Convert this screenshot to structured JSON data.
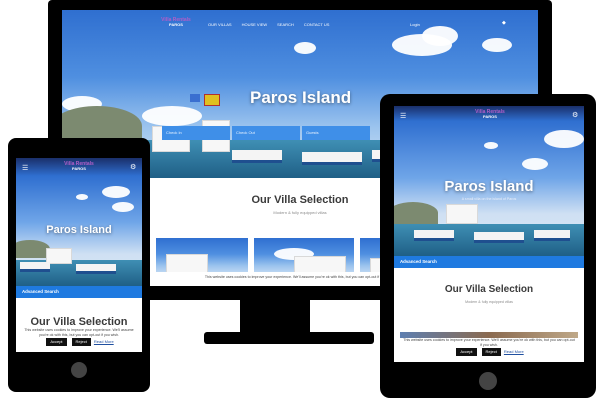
{
  "desktop": {
    "nav": {
      "brand_title": "Villa Rentals",
      "brand_sub": "PAROS",
      "links": [
        "OUR VILLAS",
        "HOUSE VIEW",
        "SEARCH",
        "CONTACT US"
      ],
      "login": "Login"
    },
    "hero_title": "Paros Island",
    "search": {
      "field1": "Check In",
      "field2": "Check Out",
      "field3": "Guests"
    },
    "selection_title": "Our Villa Selection",
    "selection_sub": "Modern & fully equipped villas",
    "cookie_text": "This website uses cookies to improve your experience. We'll assume you're ok with this, but you can opt-out if you wish."
  },
  "phone": {
    "brand_title": "Villa Rentals",
    "brand_sub": "PAROS",
    "hero_title": "Paros Island",
    "advanced_search": "Advanced Search",
    "selection_title": "Our Villa Selection",
    "cookie_text": "This website uses cookies to improve your experience. We'll assume you're ok with this, but you can opt-out if you wish.",
    "accept": "Accept",
    "reject": "Reject",
    "read_more": "Read More"
  },
  "tablet": {
    "brand_title": "Villa Rentals",
    "brand_sub": "PAROS",
    "hero_title": "Paros Island",
    "hero_sub": "A small villa on the island of Paros",
    "advanced_search": "Advanced Search",
    "selection_title": "Our Villa Selection",
    "selection_sub": "Modern & fully equipped villas",
    "cookie_text": "This website uses cookies to improve your experience. We'll assume you're ok with this, but you can opt-out if you wish.",
    "accept": "Accept",
    "reject": "Reject",
    "read_more": "Read More"
  },
  "colors": {
    "brand_purple": "#b25ec8",
    "accent_blue": "#1f7ae0",
    "device_black": "#000000"
  }
}
